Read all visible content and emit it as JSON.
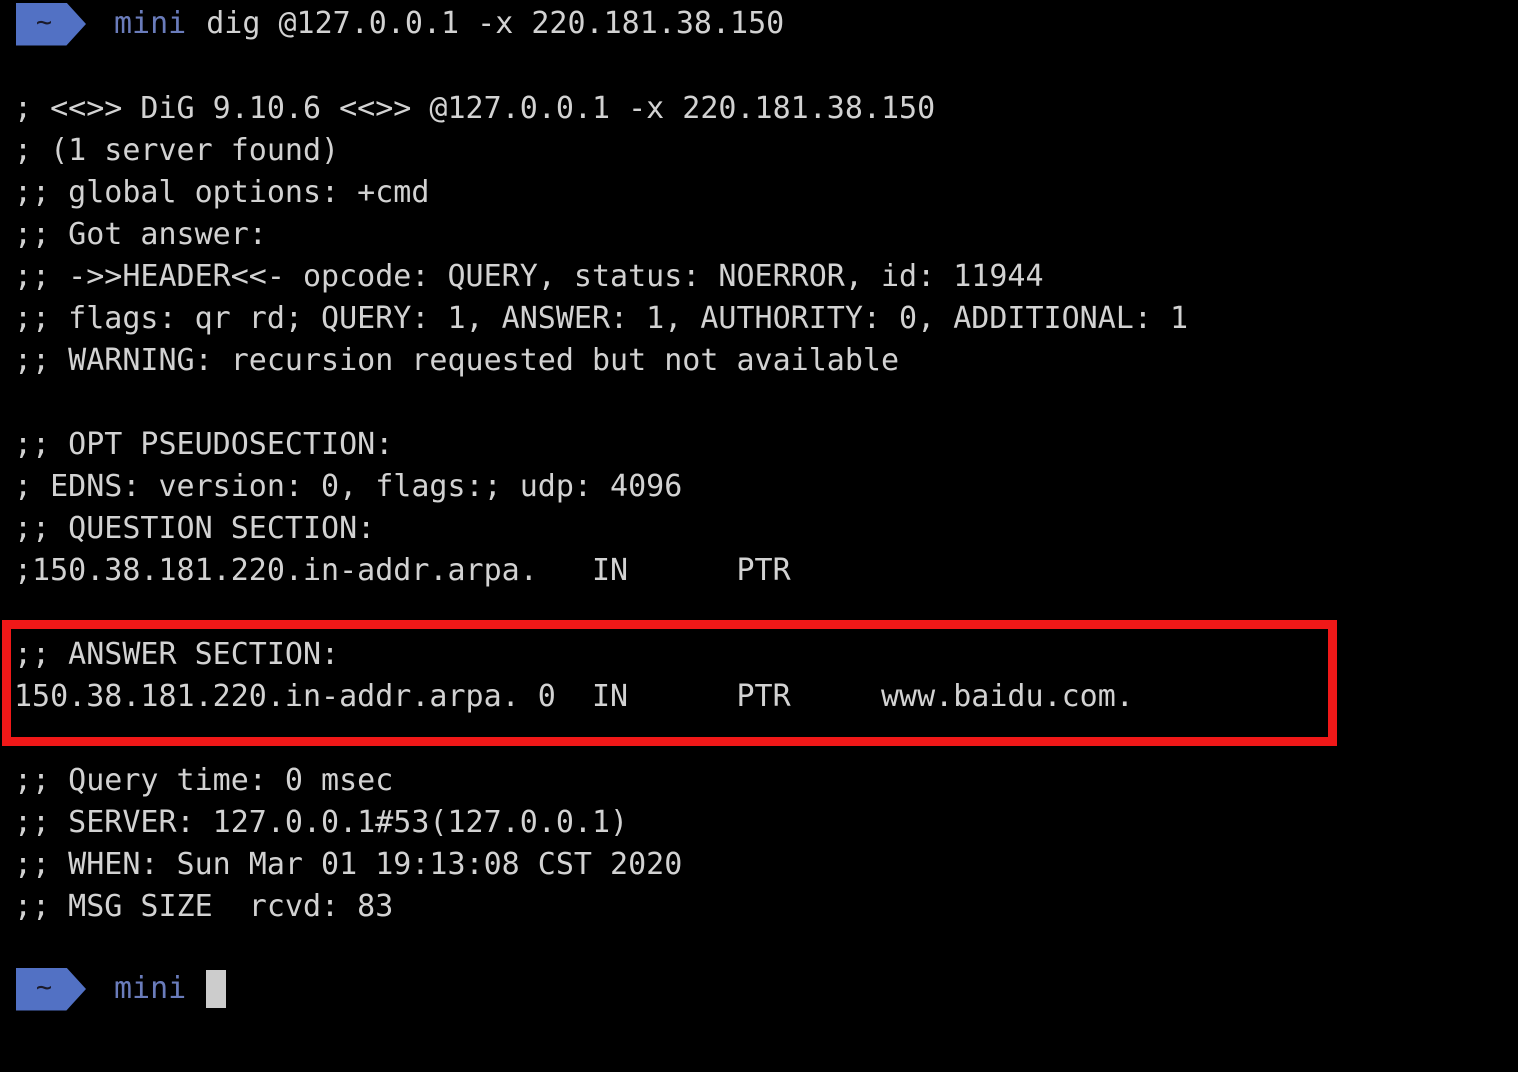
{
  "terminal": {
    "background_color": "#000000",
    "text_color": "#d2d2d2",
    "prompt_chip_color": "#5271c4",
    "prompt_host_color": "#6a7cbb",
    "highlight_color": "#f01818",
    "cursor_color": "#cccccc"
  },
  "prompt_top": {
    "chip_glyph": "~",
    "host": "mini",
    "command": "dig @127.0.0.1 -x 220.181.38.150"
  },
  "prompt_bottom": {
    "chip_glyph": "~",
    "host": "mini",
    "command": ""
  },
  "output_lines": [
    "; <<>> DiG 9.10.6 <<>> @127.0.0.1 -x 220.181.38.150",
    "; (1 server found)",
    ";; global options: +cmd",
    ";; Got answer:",
    ";; ->>HEADER<<- opcode: QUERY, status: NOERROR, id: 11944",
    ";; flags: qr rd; QUERY: 1, ANSWER: 1, AUTHORITY: 0, ADDITIONAL: 1",
    ";; WARNING: recursion requested but not available",
    "",
    ";; OPT PSEUDOSECTION:",
    "; EDNS: version: 0, flags:; udp: 4096",
    ";; QUESTION SECTION:",
    ";150.38.181.220.in-addr.arpa.   IN      PTR",
    "",
    ";; ANSWER SECTION:",
    "150.38.181.220.in-addr.arpa. 0  IN      PTR     www.baidu.com.",
    "",
    ";; Query time: 0 msec",
    ";; SERVER: 127.0.0.1#53(127.0.0.1)",
    ";; WHEN: Sun Mar 01 19:13:08 CST 2020",
    ";; MSG SIZE  rcvd: 83"
  ],
  "dig_result": {
    "dig_version": "9.10.6",
    "server_queried": "@127.0.0.1",
    "query_flag": "-x",
    "query_target": "220.181.38.150",
    "servers_found": "1",
    "global_options": "+cmd",
    "opcode": "QUERY",
    "status": "NOERROR",
    "id": "11944",
    "flags": "qr rd",
    "counts": {
      "QUERY": "1",
      "ANSWER": "1",
      "AUTHORITY": "0",
      "ADDITIONAL": "1"
    },
    "warning": "recursion requested but not available",
    "edns_version": "0",
    "edns_flags": "",
    "udp": "4096",
    "question": {
      "name": ";150.38.181.220.in-addr.arpa.",
      "class": "IN",
      "type": "PTR"
    },
    "answer": {
      "name": "150.38.181.220.in-addr.arpa.",
      "ttl": "0",
      "class": "IN",
      "type": "PTR",
      "rdata": "www.baidu.com."
    },
    "query_time": "0 msec",
    "server": "127.0.0.1#53(127.0.0.1)",
    "when": "Sun Mar 01 19:13:08 CST 2020",
    "msg_size_rcvd": "83"
  },
  "annotation": {
    "label": "answer-section-highlight",
    "color": "#f01818"
  }
}
